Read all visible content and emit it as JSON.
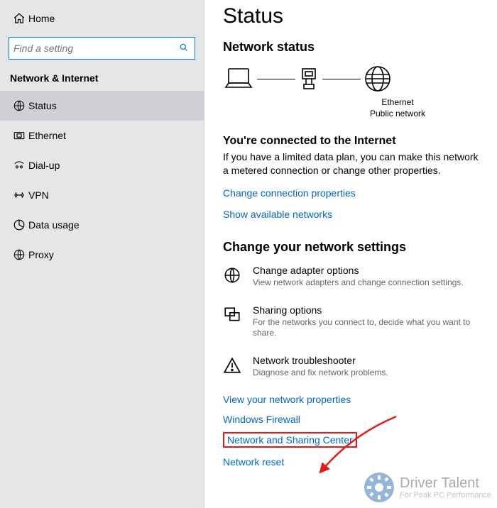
{
  "sidebar": {
    "home_label": "Home",
    "search_placeholder": "Find a setting",
    "category": "Network & Internet",
    "items": [
      {
        "label": "Status",
        "icon": "status",
        "selected": true
      },
      {
        "label": "Ethernet",
        "icon": "ethernet",
        "selected": false
      },
      {
        "label": "Dial-up",
        "icon": "dialup",
        "selected": false
      },
      {
        "label": "VPN",
        "icon": "vpn",
        "selected": false
      },
      {
        "label": "Data usage",
        "icon": "datausage",
        "selected": false
      },
      {
        "label": "Proxy",
        "icon": "proxy",
        "selected": false
      }
    ]
  },
  "main": {
    "title": "Status",
    "network_status_heading": "Network status",
    "diagram": {
      "device_label": "Ethernet",
      "network_label": "Public network"
    },
    "connected_title": "You're connected to the Internet",
    "connected_body": "If you have a limited data plan, you can make this network a metered connection or change other properties.",
    "link_change_props": "Change connection properties",
    "link_show_networks": "Show available networks",
    "change_settings_heading": "Change your network settings",
    "settings_items": [
      {
        "title": "Change adapter options",
        "desc": "View network adapters and change connection settings."
      },
      {
        "title": "Sharing options",
        "desc": "For the networks you connect to, decide what you want to share."
      },
      {
        "title": "Network troubleshooter",
        "desc": "Diagnose and fix network problems."
      }
    ],
    "links": [
      "View your network properties",
      "Windows Firewall"
    ],
    "highlight_link": "Network and Sharing Center",
    "link_network_reset": "Network reset"
  },
  "watermark": {
    "main": "Driver Talent",
    "sub": "For Peak PC Performance"
  }
}
